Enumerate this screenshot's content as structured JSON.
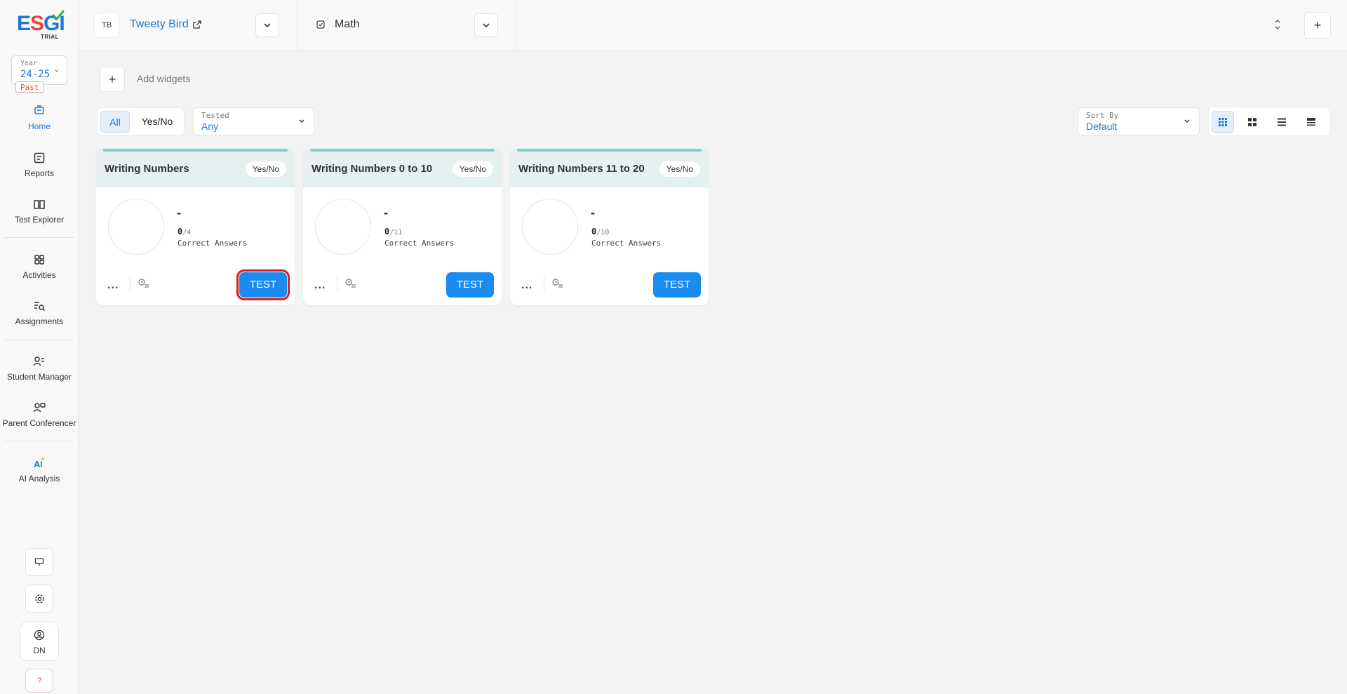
{
  "sidebar": {
    "logo_text": "ESGI",
    "logo_badge": "TRIAL",
    "year": {
      "label": "Year",
      "value": "24-25",
      "status": "Past"
    },
    "nav": [
      {
        "label": "Home",
        "icon": "home-icon",
        "active": true
      },
      {
        "label": "Reports",
        "icon": "reports-icon"
      },
      {
        "label": "Test Explorer",
        "icon": "test-explorer-icon"
      },
      {
        "label": "Activities",
        "icon": "activities-icon"
      },
      {
        "label": "Assignments",
        "icon": "assignments-icon"
      },
      {
        "label": "Student Manager",
        "icon": "student-manager-icon"
      },
      {
        "label": "Parent Conferencer",
        "icon": "parent-conferencer-icon"
      },
      {
        "label": "AI Analysis",
        "icon": "ai-analysis-icon"
      }
    ],
    "profile_initials": "DN",
    "help_label": "?"
  },
  "topbar": {
    "student": {
      "initials": "TB",
      "name": "Tweety Bird"
    },
    "subject": {
      "name": "Math"
    }
  },
  "widgets": {
    "add_label": "Add widgets",
    "add_button": "+"
  },
  "filters": {
    "tabs": [
      "All",
      "Yes/No"
    ],
    "tested": {
      "label": "Tested",
      "value": "Any"
    },
    "sort": {
      "label": "Sort By",
      "value": "Default"
    }
  },
  "cards": [
    {
      "title": "Writing Numbers",
      "badge": "Yes/No",
      "score_dash": "-",
      "correct": "0",
      "total": "4",
      "correct_label": "Correct Answers",
      "more": "...",
      "test_label": "TEST"
    },
    {
      "title": "Writing Numbers 0 to 10",
      "badge": "Yes/No",
      "score_dash": "-",
      "correct": "0",
      "total": "11",
      "correct_label": "Correct Answers",
      "more": "...",
      "test_label": "TEST"
    },
    {
      "title": "Writing Numbers 11 to 20",
      "badge": "Yes/No",
      "score_dash": "-",
      "correct": "0",
      "total": "10",
      "correct_label": "Correct Answers",
      "more": "...",
      "test_label": "TEST"
    }
  ],
  "colors": {
    "accent": "#1f78d1",
    "test_button": "#1a8cf0",
    "card_bar": "#7fcfc6",
    "highlight": "#d81b1b"
  }
}
